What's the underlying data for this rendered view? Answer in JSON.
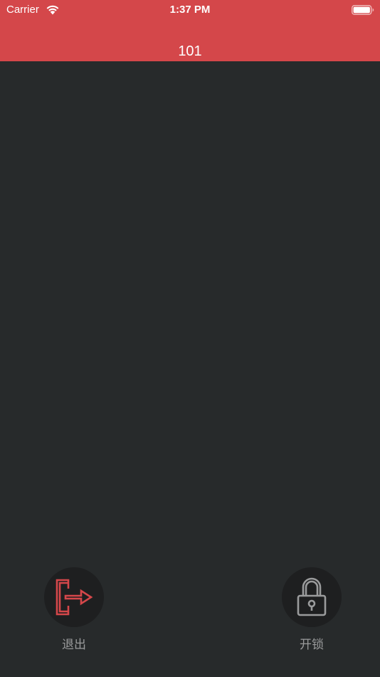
{
  "status_bar": {
    "carrier": "Carrier",
    "time": "1:37 PM",
    "wifi_icon": "wifi-icon",
    "battery_icon": "battery-icon"
  },
  "nav": {
    "title": "101"
  },
  "actions": {
    "exit": {
      "label": "退出",
      "icon": "exit-icon",
      "color": "#d4474a"
    },
    "unlock": {
      "label": "开锁",
      "icon": "lock-icon",
      "color": "#9a9b9c"
    }
  },
  "colors": {
    "header": "#d4474a",
    "background": "#272a2b",
    "button_circle": "#1e1f20"
  }
}
